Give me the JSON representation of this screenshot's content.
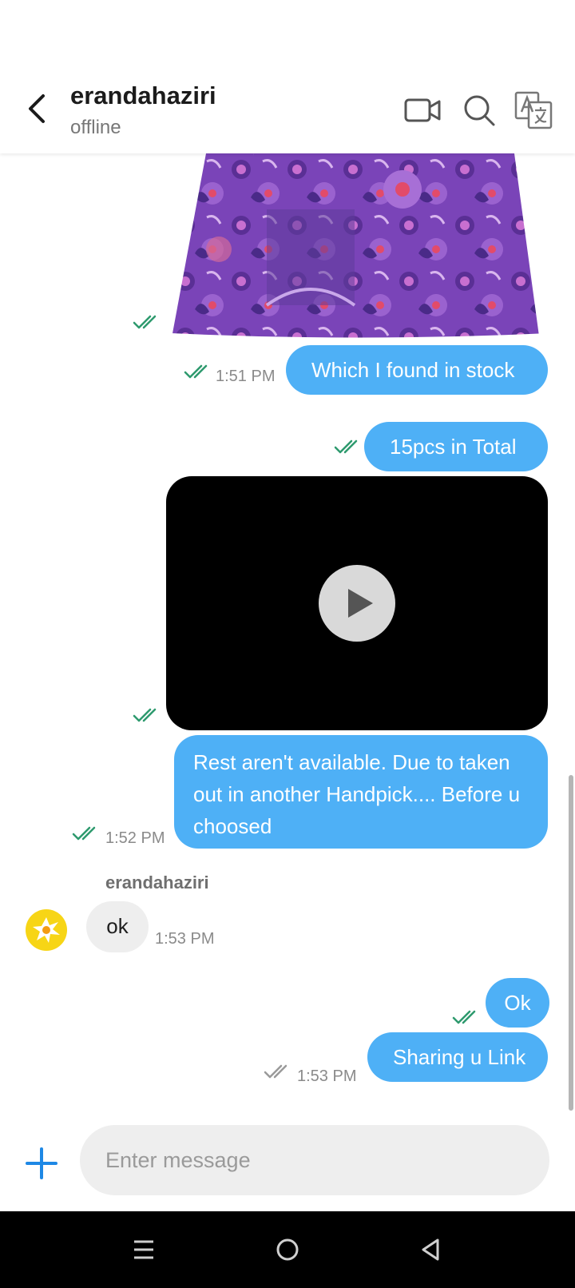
{
  "header": {
    "contact_name": "erandahaziri",
    "status": "offline",
    "icons": [
      "back-arrow-icon",
      "video-call-icon",
      "search-icon",
      "translate-icon"
    ]
  },
  "messages": [
    {
      "type": "image",
      "direction": "outgoing",
      "description_icon": "purple-patterned-top-photo"
    },
    {
      "type": "text",
      "direction": "outgoing",
      "text": "Which I found in stock",
      "time": "1:51 PM"
    },
    {
      "type": "text",
      "direction": "outgoing",
      "text": "15pcs in Total"
    },
    {
      "type": "video",
      "direction": "outgoing"
    },
    {
      "type": "text",
      "direction": "outgoing",
      "text": "Rest aren't available. Due to taken out in another Handpick.... Before u choosed",
      "time": "1:52 PM"
    },
    {
      "type": "text",
      "direction": "incoming",
      "sender": "erandahaziri",
      "text": "ok",
      "time": "1:53 PM"
    },
    {
      "type": "text",
      "direction": "outgoing",
      "text": "Ok"
    },
    {
      "type": "text",
      "direction": "outgoing",
      "text": "Sharing u Link",
      "time": "1:53 PM"
    }
  ],
  "composer": {
    "placeholder": "Enter message"
  },
  "colors": {
    "outgoing_bubble": "#4eb0f6",
    "incoming_bubble": "#eeeeee",
    "read_tick": "#2e9a6e",
    "accent": "#1e88e5"
  }
}
